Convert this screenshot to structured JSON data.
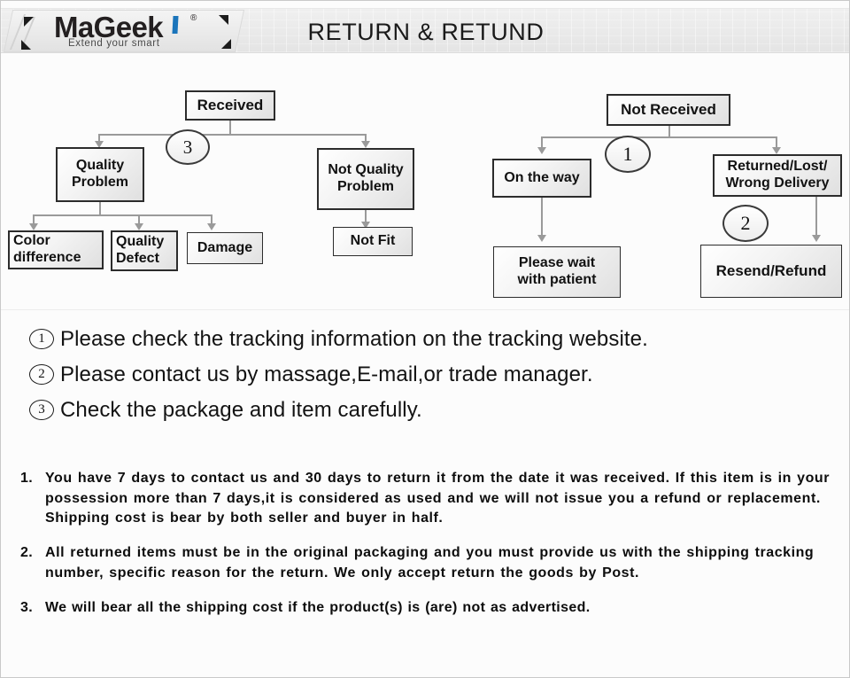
{
  "header": {
    "title": "RETURN & RETUND",
    "logo": {
      "brand": "MaGeek",
      "registered": "®",
      "tagline": "Extend your smart"
    }
  },
  "flowchart": {
    "left": {
      "root": "Received",
      "badge": "3",
      "branch_quality": "Quality\nProblem",
      "branch_not_quality": "Not Quality\nProblem",
      "leaves": [
        "Color\ndifference",
        "Quality\nDefect",
        "Damage"
      ],
      "not_quality_leaf": "Not Fit"
    },
    "right": {
      "root": "Not  Received",
      "badge_top": "1",
      "badge_mid": "2",
      "branch_on_the_way": "On the way",
      "branch_returned": "Returned/Lost/\nWrong Delivery",
      "leaf_wait": "Please wait\nwith patient",
      "leaf_resend": "Resend/Refund"
    }
  },
  "circled_notes": [
    {
      "num": "1",
      "text": "Please check the tracking information on the tracking website."
    },
    {
      "num": "2",
      "text": "Please contact us by  massage,E-mail,or trade manager."
    },
    {
      "num": "3",
      "text": "Check the package and item carefully."
    }
  ],
  "policies": [
    {
      "num": "1.",
      "text": "You have 7 days to contact us and 30 days to return it from the date it was received. If this item is in your possession more than 7 days,it is considered as used and we will not issue you a refund or replacement. Shipping cost is bear by both seller and buyer in half."
    },
    {
      "num": "2.",
      "text": "All returned items must be in the original packaging and you must provide us with the shipping tracking number, specific reason for the return. We only accept return the goods by Post."
    },
    {
      "num": "3.",
      "text": "We will bear all the shipping cost if the product(s) is (are) not as advertised."
    }
  ],
  "colors": {
    "accent_blue": "#1b75bb",
    "box_border": "#2c2c2c",
    "connector": "#9a9a9a",
    "page_bg": "#fcfcfc"
  }
}
